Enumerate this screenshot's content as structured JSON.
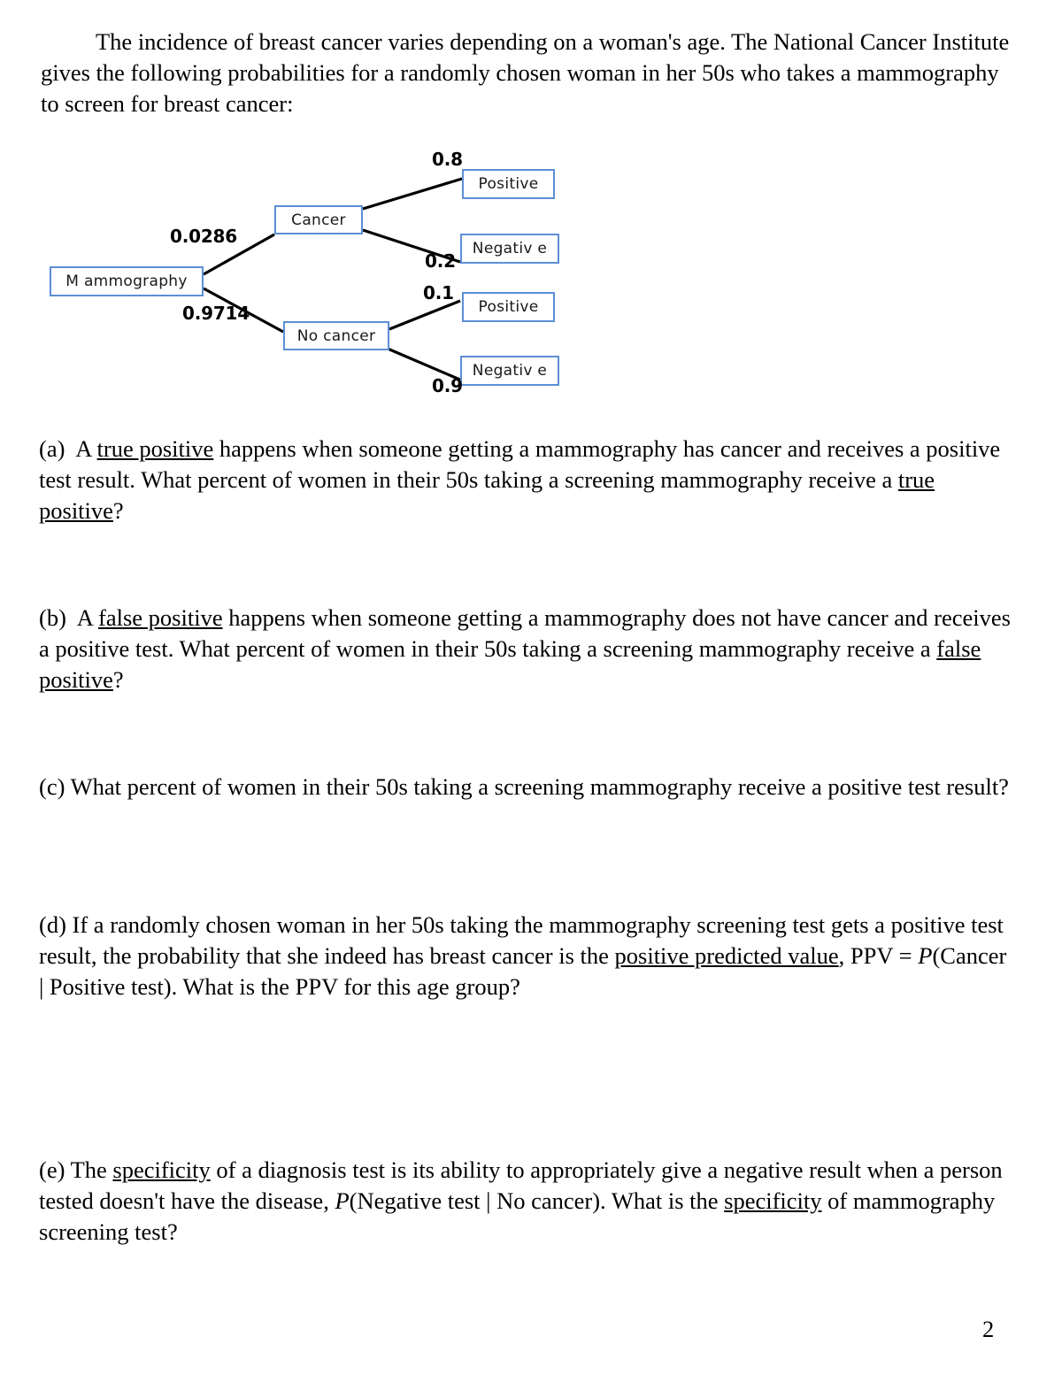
{
  "document": {
    "page_number": "2",
    "intro": {
      "indent": "",
      "text": "The incidence of breast cancer varies depending on a woman's age. The National Cancer Institute gives the following probabilities for a randomly chosen woman in her 50s who takes a mammography to screen for breast cancer:"
    }
  },
  "chart_data": {
    "type": "diagram",
    "subtype": "probability-tree",
    "title": "Mammography screening probability tree",
    "root": "Mammography",
    "nodes": [
      {
        "id": "root",
        "label": "M ammography"
      },
      {
        "id": "cancer",
        "label": "Cancer"
      },
      {
        "id": "no_cancer",
        "label": "No cancer"
      },
      {
        "id": "cancer_pos",
        "label": "Positive"
      },
      {
        "id": "cancer_neg",
        "label": "Negativ e"
      },
      {
        "id": "nocancer_pos",
        "label": "Positive"
      },
      {
        "id": "nocancer_neg",
        "label": "Negativ e"
      }
    ],
    "edges": [
      {
        "from": "root",
        "to": "cancer",
        "probability": "0.0286",
        "value": 0.0286
      },
      {
        "from": "root",
        "to": "no_cancer",
        "probability": "0.9714",
        "value": 0.9714
      },
      {
        "from": "cancer",
        "to": "cancer_pos",
        "probability": "0.8",
        "value": 0.8
      },
      {
        "from": "cancer",
        "to": "cancer_neg",
        "probability": "0.2",
        "value": 0.2
      },
      {
        "from": "no_cancer",
        "to": "nocancer_pos",
        "probability": "0.1",
        "value": 0.1
      },
      {
        "from": "no_cancer",
        "to": "nocancer_neg",
        "probability": "0.9",
        "value": 0.9
      }
    ],
    "colors": {
      "node_border": "#5b8fd6",
      "node_fill": "#ffffff",
      "edge": "#000000"
    }
  },
  "questions": {
    "a": {
      "label": "(a)",
      "seg1": "A ",
      "term1": "true positive",
      "seg2": " happens when someone getting a mammography has cancer and receives a positive test result. What percent of women in their 50s taking a screening mammography receive a ",
      "term2": "true positive",
      "seg3": "?"
    },
    "b": {
      "label": "(b)",
      "seg1": "A ",
      "term1": "false positive",
      "seg2": " happens when someone getting a mammography does not have cancer and receives a positive test. What percent of women in their 50s taking a screening mammography receive a ",
      "term2": "false positive",
      "seg3": "?"
    },
    "c": {
      "label": "(c)",
      "seg1": " What percent of women in their 50s taking a screening mammography receive a positive test result?"
    },
    "d": {
      "label": "(d)",
      "seg1": " If a randomly chosen woman in her 50s taking the mammography screening test gets a positive test result, the probability that she indeed has breast cancer is the ",
      "term1": "positive predicted value",
      "seg2": ", PPV = ",
      "italic1": "P",
      "seg3": "(Cancer | Positive test). What is the PPV for this age group?"
    },
    "e": {
      "label": "(e)",
      "seg1": " The ",
      "term1": "specificity",
      "seg2": " of a diagnosis test is its ability to appropriately give a negative result when a person tested doesn't have the disease, ",
      "italic1": "P",
      "seg3": "(Negative test | No cancer). What is the ",
      "term2": "specificity",
      "seg4": " of mammography screening test?"
    }
  }
}
